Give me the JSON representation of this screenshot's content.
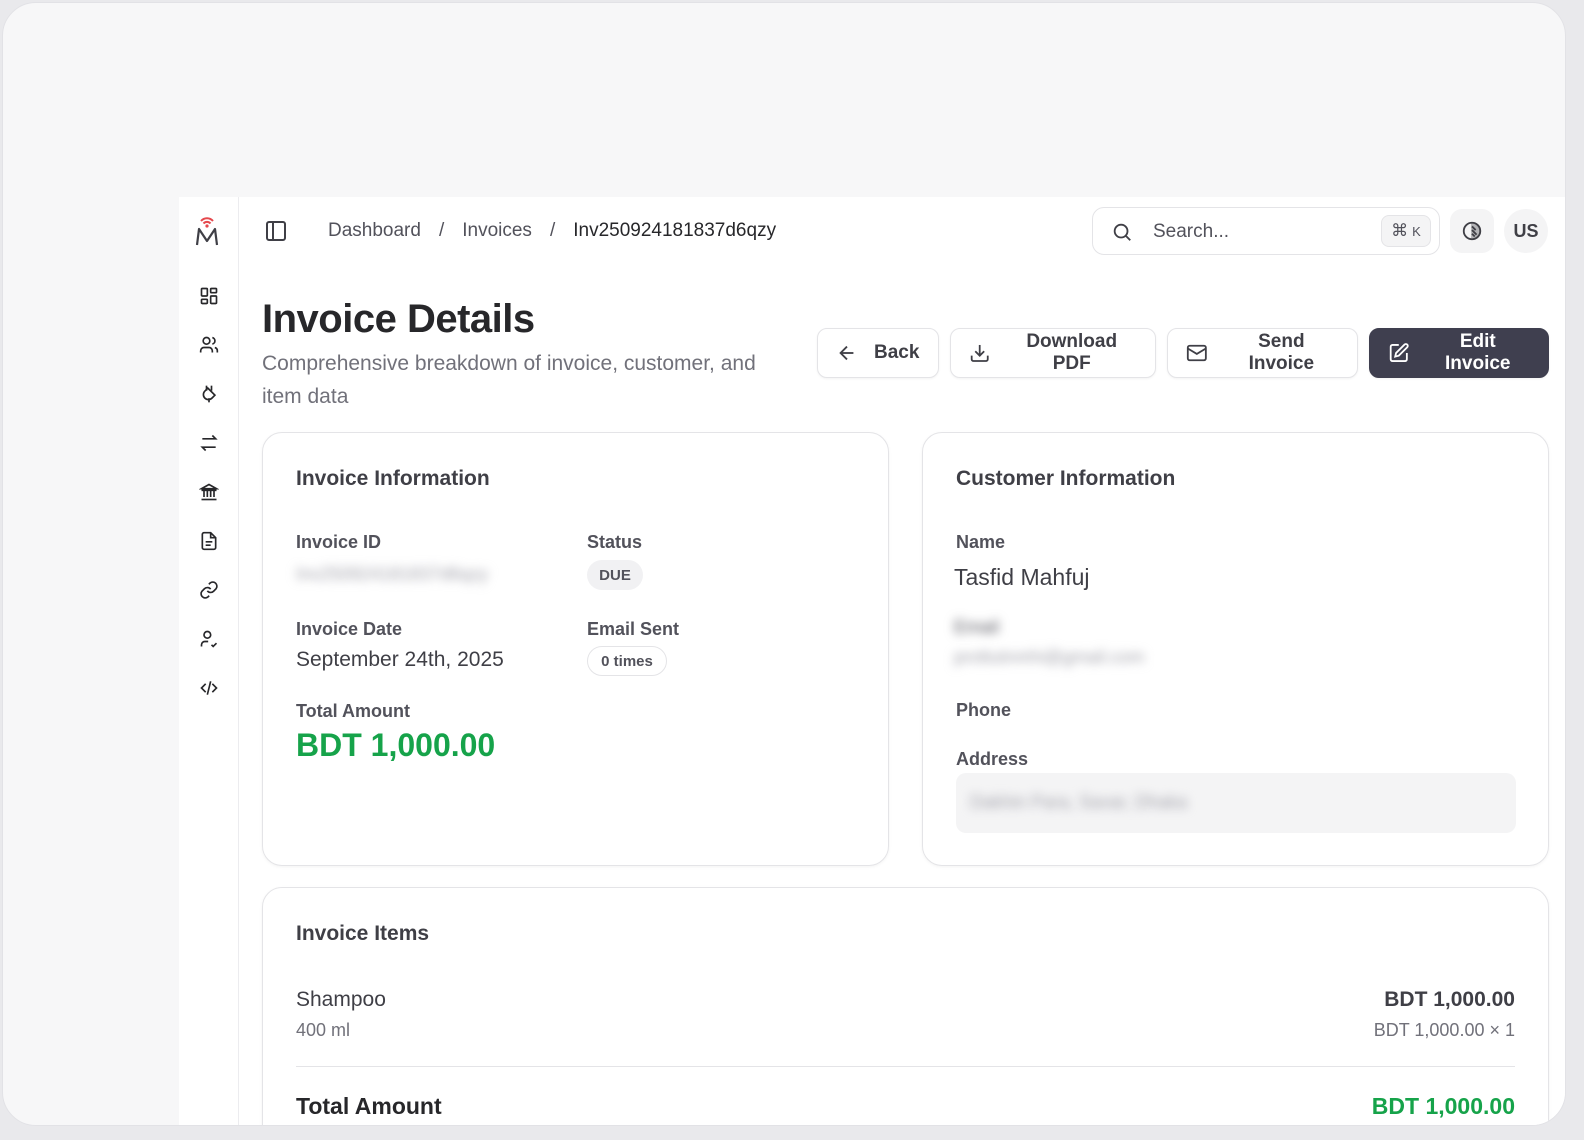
{
  "breadcrumb": {
    "dashboard": "Dashboard",
    "invoices": "Invoices",
    "current": "Inv250924181837d6qzy",
    "separator": "/"
  },
  "search": {
    "placeholder": "Search...",
    "shortcut_symbol": "⌘",
    "shortcut_key": "K"
  },
  "user": {
    "initials": "US"
  },
  "page": {
    "title": "Invoice Details",
    "subtitle": "Comprehensive breakdown of invoice, customer, and item data"
  },
  "actions": {
    "back": "Back",
    "download_pdf": "Download PDF",
    "send_invoice": "Send Invoice",
    "edit_invoice": "Edit Invoice"
  },
  "invoice_info": {
    "heading": "Invoice Information",
    "invoice_id_label": "Invoice ID",
    "invoice_id_value": "Inv250924181837d6qzy",
    "status_label": "Status",
    "status_value": "DUE",
    "invoice_date_label": "Invoice Date",
    "invoice_date_value": "September 24th, 2025",
    "email_sent_label": "Email Sent",
    "email_sent_value": "0 times",
    "total_amount_label": "Total Amount",
    "total_amount_value": "BDT 1,000.00"
  },
  "customer_info": {
    "heading": "Customer Information",
    "name_label": "Name",
    "name_value": "Tasfid Mahfuj",
    "email_label": "Email",
    "email_value": "prottutnmhi@gmail.com",
    "phone_label": "Phone",
    "address_label": "Address",
    "address_value": "Dakhin Para, Savar, Dhaka"
  },
  "invoice_items": {
    "heading": "Invoice Items",
    "items": [
      {
        "name": "Shampoo",
        "description": "400 ml",
        "line_total": "BDT 1,000.00",
        "calc": "BDT 1,000.00 × 1"
      }
    ],
    "total_label": "Total Amount",
    "total_value": "BDT 1,000.00"
  },
  "colors": {
    "accent_green": "#16a34a",
    "primary_button": "#3f3f4f",
    "logo_red": "#e5484d"
  },
  "icons": {
    "rail": [
      "dashboard-icon",
      "users-icon",
      "plug-icon",
      "transfer-icon",
      "bank-icon",
      "document-icon",
      "link-icon",
      "user-check-icon",
      "code-icon"
    ]
  }
}
